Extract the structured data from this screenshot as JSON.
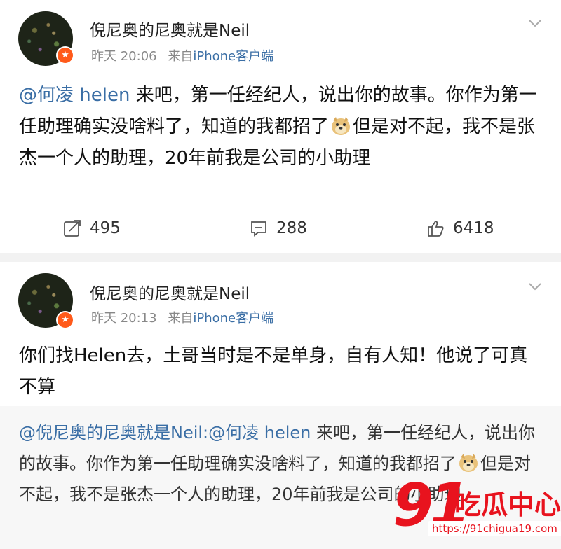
{
  "post1": {
    "username": "倪尼奥的尼奥就是Neil",
    "time": "昨天 20:06",
    "source_prefix": "来自",
    "source": "iPhone客户端",
    "mention": "@何凌 helen",
    "text_before_emoji": " 来吧，第一任经纪人，说出你的故事。你作为第一任助理确实没啥料了，知道的我都招了",
    "text_after_emoji": "但是对不起，我不是张杰一个人的助理，20年前我是公司的小助理",
    "reposts": "495",
    "comments": "288",
    "likes": "6418"
  },
  "post2": {
    "username": "倪尼奥的尼奥就是Neil",
    "time": "昨天 20:13",
    "source_prefix": "来自",
    "source": "iPhone客户端",
    "text": "你们找Helen去，土哥当时是不是单身，自有人知！他说了可真不算",
    "repost_mention": "@倪尼奥的尼奥就是Neil:@何凌 helen",
    "repost_text_before_emoji": " 来吧，第一任经纪人，说出你的故事。你作为第一任助理确实没啥料了，知道的我都招了",
    "repost_text_after_emoji": "但是对不起，我不是张杰一个人的助理，20年前我是公司的小助理"
  },
  "watermark": {
    "number": "91",
    "title": "吃瓜中心",
    "url": "https://91chigua19.com"
  },
  "icons": {
    "repost": "repost-icon",
    "comment": "comment-icon",
    "like": "like-icon",
    "more": "chevron-down-icon",
    "verified": "verified-badge-icon",
    "emoji": "doge-emoji-icon"
  },
  "colors": {
    "link": "#3a6ea5",
    "badge": "#ff5a1a",
    "watermark": "#e8131e"
  }
}
